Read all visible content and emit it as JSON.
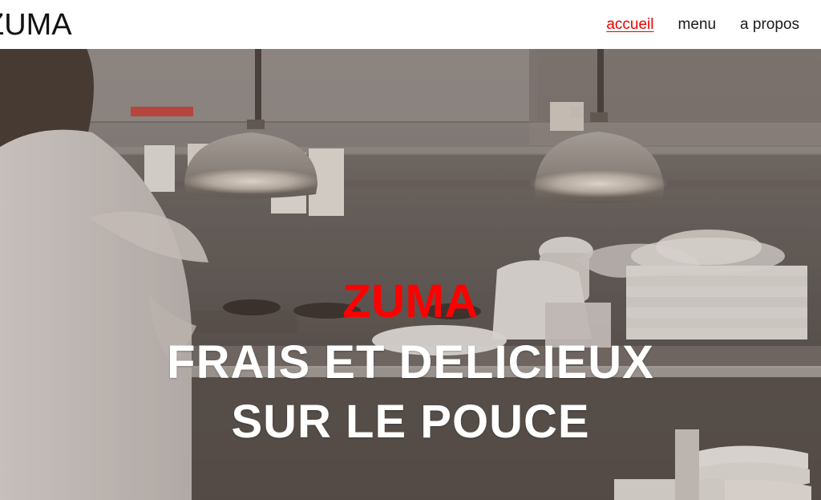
{
  "header": {
    "brand": "ZUMA",
    "nav": [
      {
        "label": "accueil",
        "active": true
      },
      {
        "label": "menu",
        "active": false
      },
      {
        "label": "a propos",
        "active": false
      }
    ]
  },
  "hero": {
    "title": "ZUMA",
    "tagline_line_1": "FRAIS ET DELICIEUX",
    "tagline_line_2": "SUR LE POUCE"
  },
  "theme": {
    "accent": "#ff0000",
    "nav_active": "#ea0000",
    "text_dark": "#1a1a1a",
    "hero_text": "#ffffff"
  }
}
